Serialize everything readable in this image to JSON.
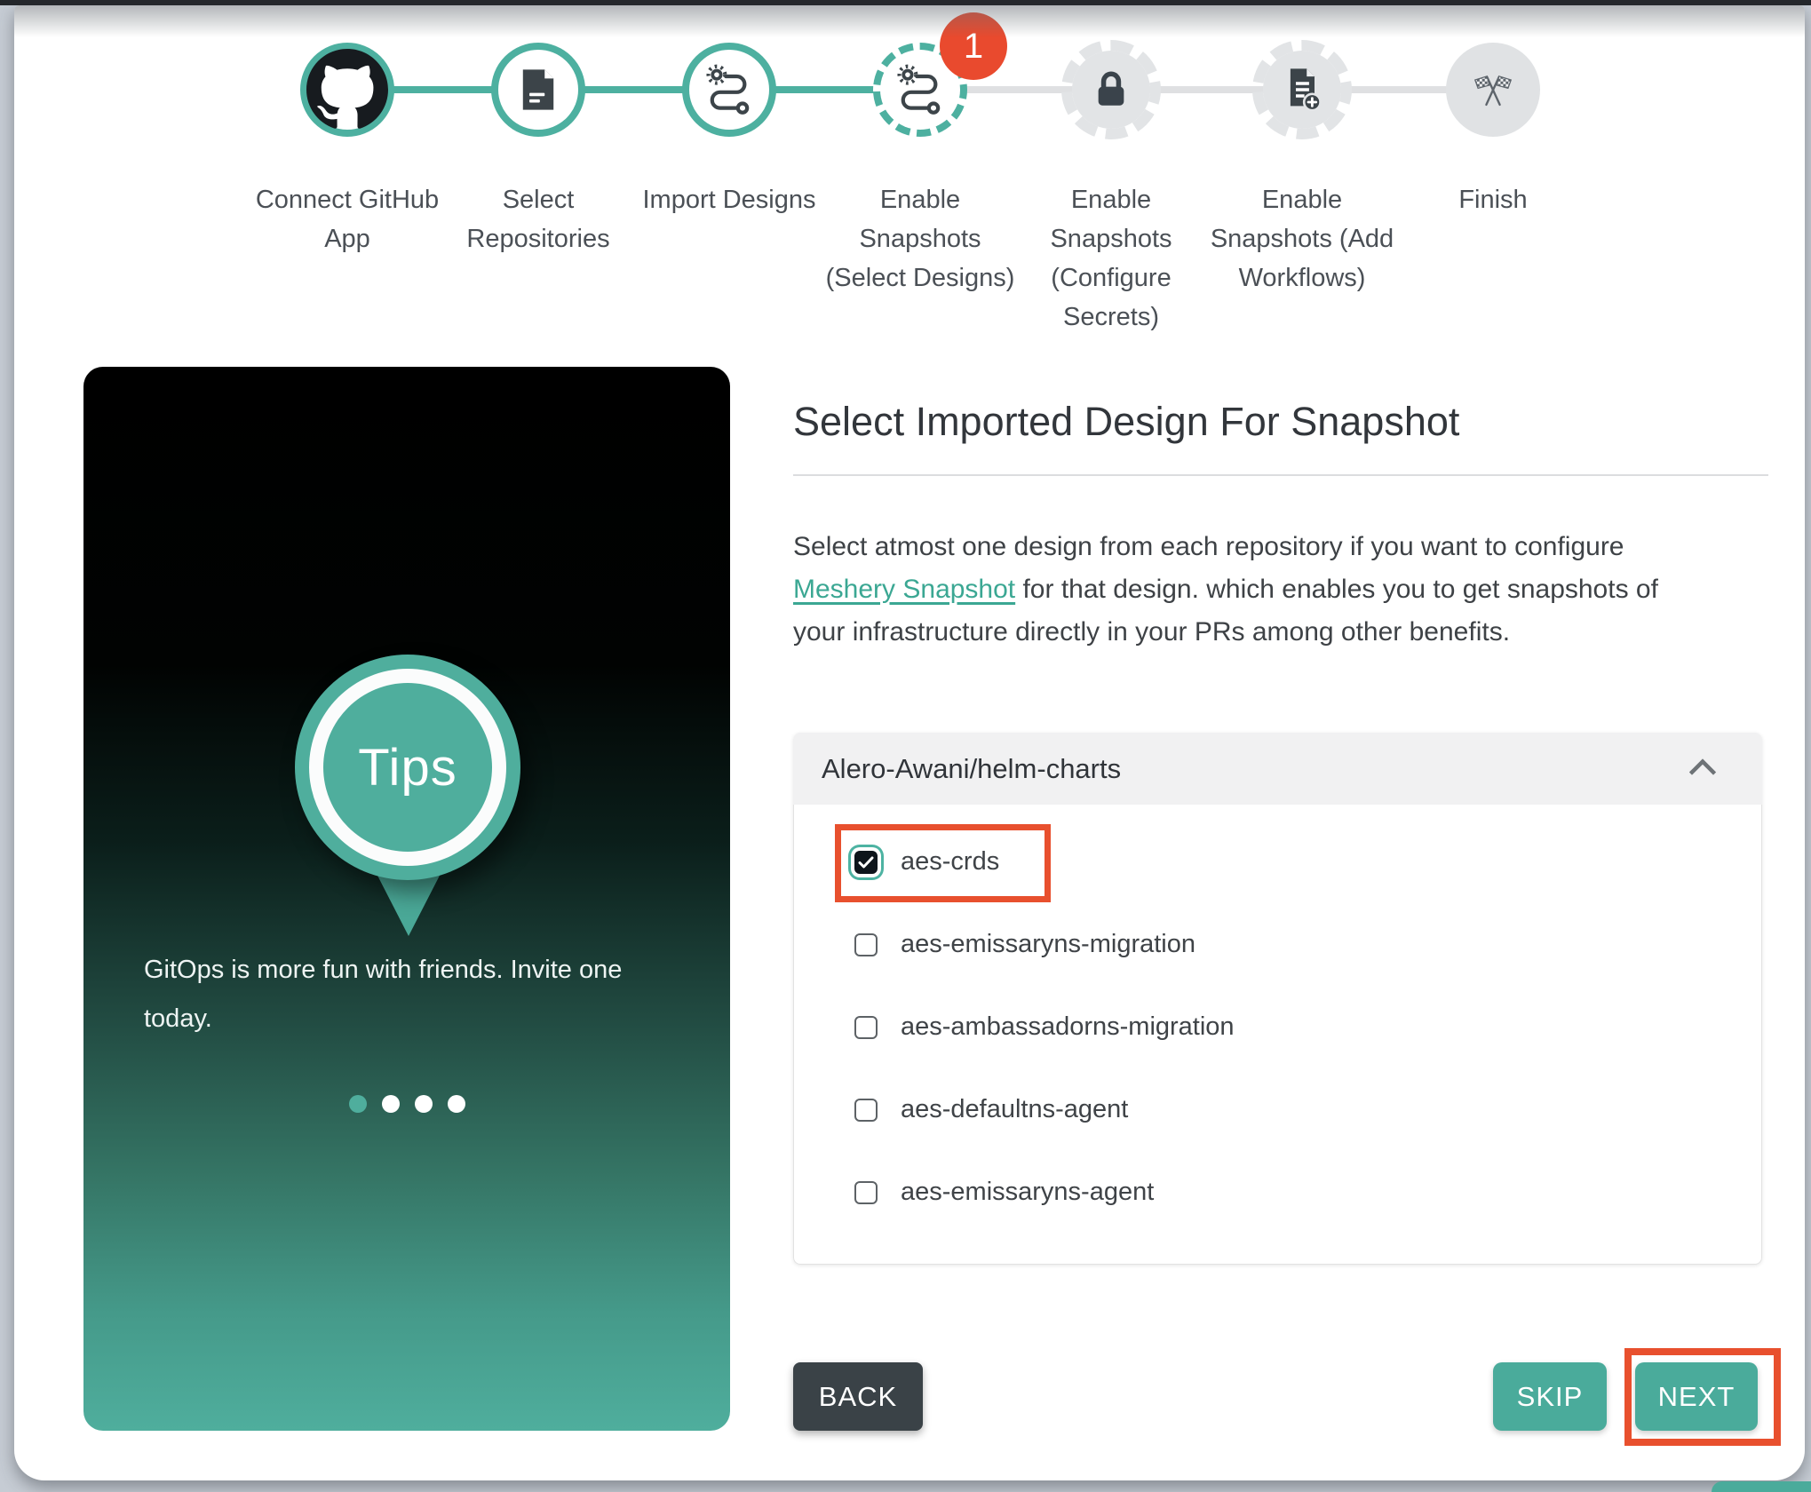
{
  "stepper": {
    "steps": [
      {
        "label": "Connect GitHub App",
        "label_lines": [
          "Connect GitHub",
          "App"
        ],
        "icon": "github-icon",
        "status": "completed"
      },
      {
        "label": "Select Repositories",
        "label_lines": [
          "Select",
          "Repositories"
        ],
        "icon": "repository-icon",
        "status": "completed"
      },
      {
        "label": "Import Designs",
        "label_lines": [
          "Import Designs"
        ],
        "icon": "design-path-icon",
        "status": "completed"
      },
      {
        "label": "Enable Snapshots (Select Designs)",
        "label_lines": [
          "Enable",
          "Snapshots",
          "(Select Designs)"
        ],
        "icon": "design-path-icon",
        "status": "current",
        "badge": "1"
      },
      {
        "label": "Enable Snapshots (Configure Secrets)",
        "label_lines": [
          "Enable",
          "Snapshots",
          "(Configure",
          "Secrets)"
        ],
        "icon": "lock-icon",
        "status": "upcoming"
      },
      {
        "label": "Enable Snapshots (Add Workflows)",
        "label_lines": [
          "Enable",
          "Snapshots (Add",
          "Workflows)"
        ],
        "icon": "add-document-icon",
        "status": "upcoming"
      },
      {
        "label": "Finish",
        "label_lines": [
          "Finish"
        ],
        "icon": "finish-flags-icon",
        "status": "finish"
      }
    ]
  },
  "tips_card": {
    "badge_text": "Tips",
    "message": "GitOps is more fun with friends. Invite one today.",
    "carousel": {
      "count": 4,
      "active_index": 0
    }
  },
  "main": {
    "title": "Select Imported Design For Snapshot",
    "description_before_link": "Select atmost one design from each repository if you want to configure ",
    "link_text": "Meshery Snapshot",
    "description_after_link": " for that design. which enables you to get snapshots of your infrastructure directly in your PRs among other benefits.",
    "repository": {
      "name": "Alero-Awani/helm-charts",
      "designs": [
        {
          "label": "aes-crds",
          "checked": true,
          "highlighted": true
        },
        {
          "label": "aes-emissaryns-migration",
          "checked": false
        },
        {
          "label": "aes-ambassadorns-migration",
          "checked": false
        },
        {
          "label": "aes-defaultns-agent",
          "checked": false
        },
        {
          "label": "aes-emissaryns-agent",
          "checked": false
        }
      ]
    },
    "buttons": {
      "back": "BACK",
      "skip": "SKIP",
      "next": "NEXT"
    }
  },
  "colors": {
    "accent": "#4AAB9B",
    "stepper_teal": "#4DB0A0",
    "link": "#3BA793",
    "badge_red": "#E94A2E",
    "annotation_red": "#E8502E",
    "dark_button": "#3A4247",
    "icon_dark": "#3C4449",
    "pending_gray": "#E2E4E6",
    "connector_gray": "#DFE0E2",
    "backdrop": "#C6CCD4"
  }
}
